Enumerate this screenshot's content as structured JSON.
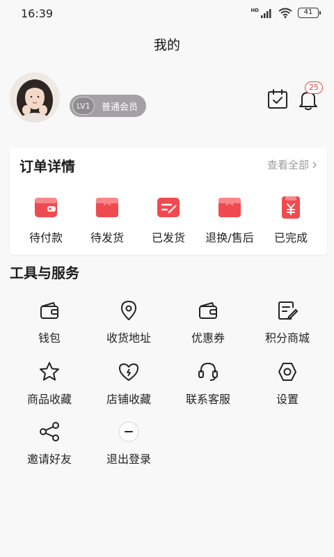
{
  "status_bar": {
    "time": "16:39",
    "battery": "41",
    "network": "HD"
  },
  "header": {
    "title": "我的"
  },
  "profile": {
    "level": "LV1",
    "member_type": "普通会员",
    "notification_count": "25"
  },
  "orders": {
    "title": "订单详情",
    "view_all": "查看全部",
    "items": [
      {
        "label": "待付款",
        "icon": "wallet-icon"
      },
      {
        "label": "待发货",
        "icon": "box-icon"
      },
      {
        "label": "已发货",
        "icon": "shipped-icon"
      },
      {
        "label": "退换/售后",
        "icon": "return-icon"
      },
      {
        "label": "已完成",
        "icon": "completed-icon"
      }
    ]
  },
  "tools": {
    "title": "工具与服务",
    "items": [
      {
        "label": "钱包",
        "icon": "wallet-icon"
      },
      {
        "label": "收货地址",
        "icon": "location-icon"
      },
      {
        "label": "优惠券",
        "icon": "coupon-icon"
      },
      {
        "label": "积分商城",
        "icon": "points-icon"
      },
      {
        "label": "商品收藏",
        "icon": "star-icon"
      },
      {
        "label": "店铺收藏",
        "icon": "heart-icon"
      },
      {
        "label": "联系客服",
        "icon": "headset-icon"
      },
      {
        "label": "设置",
        "icon": "settings-icon"
      },
      {
        "label": "邀请好友",
        "icon": "share-icon"
      },
      {
        "label": "退出登录",
        "icon": "logout-icon"
      }
    ]
  },
  "colors": {
    "accent": "#ef4a4f",
    "accent_light": "#f9868a",
    "text": "#222222",
    "muted": "#9a9a9a"
  }
}
